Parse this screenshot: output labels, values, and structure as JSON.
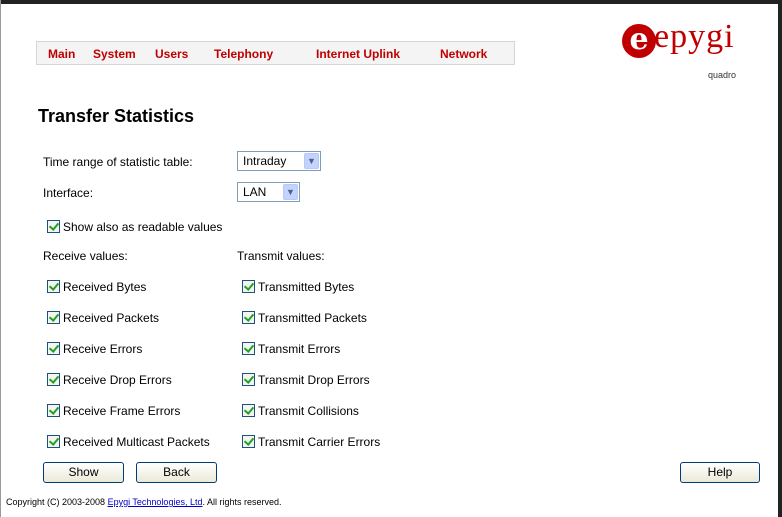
{
  "nav": {
    "items": [
      "Main",
      "System",
      "Users",
      "Telephony",
      "Internet Uplink",
      "Network"
    ]
  },
  "logo": {
    "brand": "epygi",
    "sub": "quadro"
  },
  "page": {
    "title": "Transfer Statistics"
  },
  "form": {
    "time_range_label": "Time range of statistic table:",
    "time_range_value": "Intraday",
    "interface_label": "Interface:",
    "interface_value": "LAN",
    "show_readable_label": "Show also as readable values",
    "receive_header": "Receive values:",
    "transmit_header": "Transmit values:",
    "receive": [
      "Received Bytes",
      "Received Packets",
      "Receive Errors",
      "Receive Drop Errors",
      "Receive Frame Errors",
      "Received Multicast Packets"
    ],
    "transmit": [
      "Transmitted Bytes",
      "Transmitted Packets",
      "Transmit Errors",
      "Transmit Drop Errors",
      "Transmit Collisions",
      "Transmit Carrier Errors"
    ]
  },
  "buttons": {
    "show": "Show",
    "back": "Back",
    "help": "Help"
  },
  "footer": {
    "prefix": "Copyright (C) 2003-2008 ",
    "link": "Epygi Technologies, Ltd",
    "suffix": ". All rights reserved."
  },
  "colors": {
    "nav_text": "#c00000",
    "brand": "#c00000",
    "checkbox_check": "#21a121"
  }
}
